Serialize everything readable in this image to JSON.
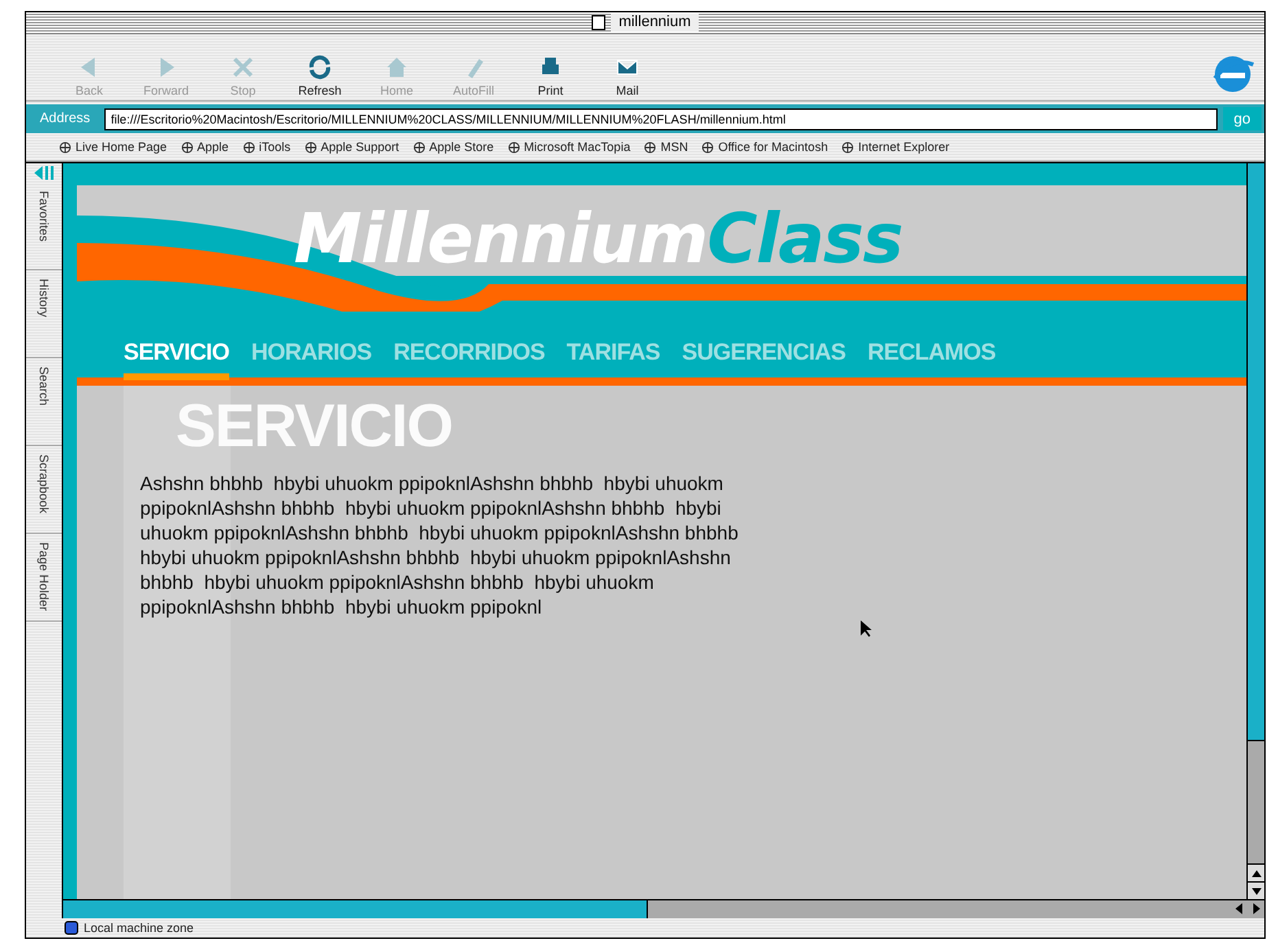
{
  "window": {
    "title": "millennium"
  },
  "toolbar": [
    {
      "label": "Back",
      "kind": "back",
      "disabled": true
    },
    {
      "label": "Forward",
      "kind": "forward",
      "disabled": true
    },
    {
      "label": "Stop",
      "kind": "stop",
      "disabled": true
    },
    {
      "label": "Refresh",
      "kind": "refresh",
      "disabled": false
    },
    {
      "label": "Home",
      "kind": "home",
      "disabled": true
    },
    {
      "label": "AutoFill",
      "kind": "autofill",
      "disabled": true
    },
    {
      "label": "Print",
      "kind": "print",
      "disabled": false
    },
    {
      "label": "Mail",
      "kind": "mail",
      "disabled": false
    }
  ],
  "address": {
    "label": "Address",
    "value": "file:///Escritorio%20Macintosh/Escritorio/MILLENNIUM%20CLASS/MILLENNIUM/MILLENNIUM%20FLASH/millennium.html",
    "go": "go"
  },
  "favorites": [
    "Live Home Page",
    "Apple",
    "iTools",
    "Apple Support",
    "Apple Store",
    "Microsoft MacTopia",
    "MSN",
    "Office for Macintosh",
    "Internet Explorer"
  ],
  "sidebar_tabs": [
    "Favorites",
    "History",
    "Search",
    "Scrapbook",
    "Page Holder"
  ],
  "page": {
    "logo": {
      "first": "Millennium",
      "second": "Class"
    },
    "nav": [
      {
        "label": "SERVICIO",
        "selected": true
      },
      {
        "label": "HORARIOS",
        "selected": false
      },
      {
        "label": "RECORRIDOS",
        "selected": false
      },
      {
        "label": "TARIFAS",
        "selected": false
      },
      {
        "label": "SUGERENCIAS",
        "selected": false
      },
      {
        "label": "RECLAMOS",
        "selected": false
      }
    ],
    "heading": "SERVICIO",
    "body": "Ashshn bhbhb  hbybi uhuokm ppipoknlAshshn bhbhb  hbybi uhuokm ppipoknlAshshn bhbhb  hbybi uhuokm ppipoknlAshshn bhbhb  hbybi uhuokm ppipoknlAshshn bhbhb  hbybi uhuokm ppipoknlAshshn bhbhb  hbybi uhuokm ppipoknlAshshn bhbhb  hbybi uhuokm ppipoknlAshshn bhbhb  hbybi uhuokm ppipoknlAshshn bhbhb  hbybi uhuokm ppipoknlAshshn bhbhb  hbybi uhuokm ppipoknl"
  },
  "status_bar": "Local machine zone"
}
